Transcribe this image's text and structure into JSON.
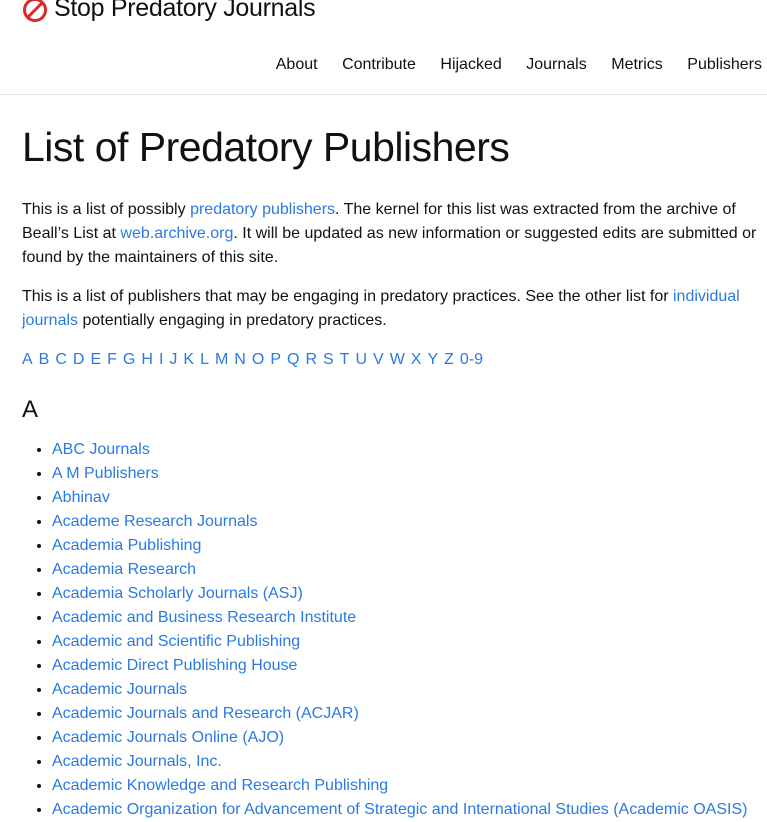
{
  "site": {
    "title": "Stop Predatory Journals",
    "logo_icon": "prohibited-sign-icon",
    "logo_color": "#e0252b"
  },
  "nav": [
    {
      "label": "About"
    },
    {
      "label": "Contribute"
    },
    {
      "label": "Hijacked"
    },
    {
      "label": "Journals"
    },
    {
      "label": "Metrics"
    },
    {
      "label": "Publishers"
    }
  ],
  "page": {
    "title": "List of Predatory Publishers",
    "intro1": {
      "t1": "This is a list of possibly ",
      "link1": "predatory publishers",
      "t2": ". The kernel for this list was extracted from the archive of Beall’s List at ",
      "link2": "web.archive.org",
      "t3": ". It will be updated as new information or suggested edits are submitted or found by the maintainers of this site."
    },
    "intro2": {
      "t1": "This is a list of publishers that may be engaging in predatory practices. See the other list for ",
      "link1": "individual journals",
      "t2": " potentially engaging in predatory practices."
    },
    "alphabet": [
      "A",
      "B",
      "C",
      "D",
      "E",
      "F",
      "G",
      "H",
      "I",
      "J",
      "K",
      "L",
      "M",
      "N",
      "O",
      "P",
      "Q",
      "R",
      "S",
      "T",
      "U",
      "V",
      "W",
      "X",
      "Y",
      "Z",
      "0-9"
    ],
    "section_letter": "A",
    "publishers": [
      "ABC Journals",
      "A M Publishers",
      "Abhinav",
      "Academe Research Journals",
      "Academia Publishing",
      "Academia Research",
      "Academia Scholarly Journals (ASJ)",
      "Academic and Business Research Institute",
      "Academic and Scientific Publishing",
      "Academic Direct Publishing House",
      "Academic Journals",
      "Academic Journals and Research (ACJAR)",
      "Academic Journals Online (AJO)",
      "Academic Journals, Inc.",
      "Academic Knowledge and Research Publishing",
      "Academic Organization for Advancement of Strategic and International Studies (Academic OASIS)"
    ]
  },
  "colors": {
    "link": "#2a7ae2",
    "text": "#111111",
    "background": "#ffffff"
  }
}
